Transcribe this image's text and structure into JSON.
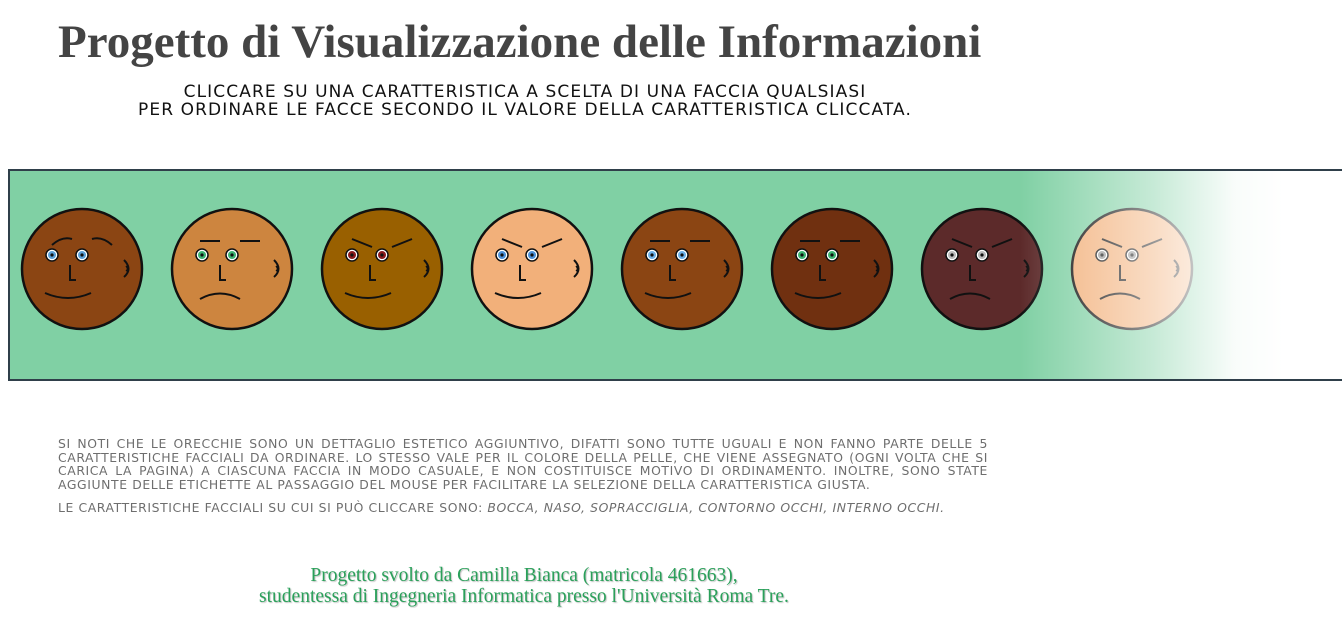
{
  "title": "Progetto di Visualizzazione delle Informazioni",
  "instructions": {
    "line1": "CLICCARE SU UNA CARATTERISTICA A SCELTA DI UNA FACCIA QUALSIASI",
    "line2": "PER ORDINARE LE FACCE SECONDO IL VALORE DELLA CARATTERISTICA CLICCATA."
  },
  "panel": {
    "background_color": "#80d0a4",
    "faces": [
      {
        "skin": "#8b4513",
        "iris": "#5aa0d8",
        "brow": "sad",
        "mouth": "smile"
      },
      {
        "skin": "#cd853f",
        "iris": "#3cb371",
        "brow": "flat",
        "mouth": "frown"
      },
      {
        "skin": "#996000",
        "iris": "#8b1a1a",
        "brow": "angry",
        "mouth": "smile"
      },
      {
        "skin": "#f2b07a",
        "iris": "#4a90d9",
        "brow": "angry",
        "mouth": "smile"
      },
      {
        "skin": "#8b4513",
        "iris": "#6ab0e8",
        "brow": "flat",
        "mouth": "smile"
      },
      {
        "skin": "#703010",
        "iris": "#3cb371",
        "brow": "flat",
        "mouth": "smile"
      },
      {
        "skin": "#5c2a2a",
        "iris": "#bbbbbb",
        "brow": "angry",
        "mouth": "frown"
      },
      {
        "skin": "#f2b07a",
        "iris": "#999999",
        "brow": "angry",
        "mouth": "frown"
      }
    ]
  },
  "notes": {
    "paragraph": "Si noti che le orecchie sono un dettaglio estetico aggiuntivo, difatti sono tutte uguali e non fanno parte delle 5 caratteristiche facciali da ordinare. Lo stesso vale per il colore della pelle, che viene assegnato (ogni volta che si carica la pagina) a ciascuna faccia in modo casuale, e non costituisce motivo di ordinamento. Inoltre, sono state aggiunte delle etichette al passaggio del mouse per facilitare la selezione della caratteristica giusta.",
    "features_intro": "Le caratteristiche facciali su cui si può cliccare sono: ",
    "features_list": "bocca, naso, sopracciglia, contorno occhi, interno occhi."
  },
  "credits": {
    "line1": "Progetto svolto da Camilla Bianca (matricola 461663),",
    "line2": "studentessa di Ingegneria Informatica presso l'Università Roma Tre."
  }
}
